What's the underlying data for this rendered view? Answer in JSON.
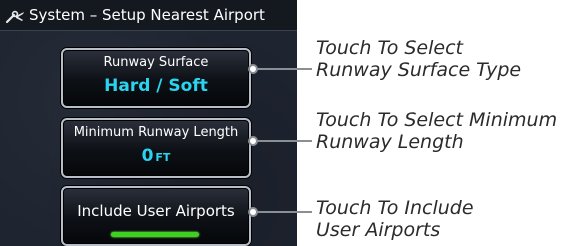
{
  "title_bar": {
    "title": "System – Setup Nearest Airport",
    "icon": "wrench-plane-icon"
  },
  "buttons": {
    "runway_surface": {
      "label": "Runway Surface",
      "value": "Hard / Soft"
    },
    "min_runway_length": {
      "label": "Minimum Runway Length",
      "value": "0",
      "unit": "FT"
    },
    "include_user_airports": {
      "label": "Include User Airports",
      "toggle_state": "on",
      "toggle_color": "#40d020"
    }
  },
  "callouts": [
    {
      "line1": "Touch To Select",
      "line2": "Runway Surface Type"
    },
    {
      "line1": "Touch To Select Minimum",
      "line2": "Runway Length"
    },
    {
      "line1": "Touch To Include",
      "line2": "User Airports"
    }
  ],
  "colors": {
    "value_text": "#2ad4f0",
    "screen_bg": "#1e2430"
  }
}
